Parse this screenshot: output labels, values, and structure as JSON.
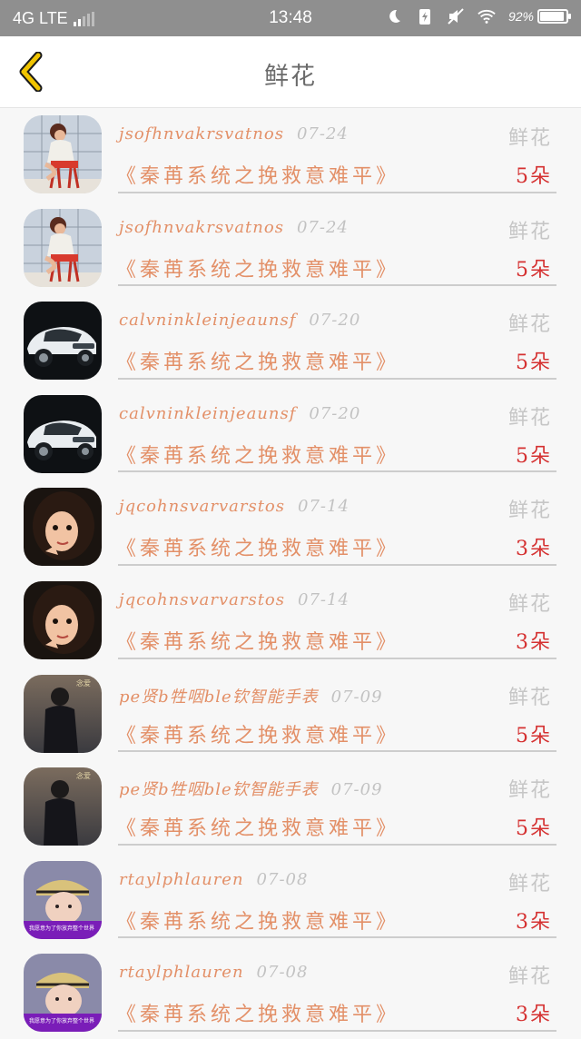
{
  "status_bar": {
    "network": "4G LTE",
    "time": "13:48",
    "battery": "92%",
    "battery_level": 0.92
  },
  "header": {
    "title": "鲜花",
    "back_icon": "chevron-left-icon",
    "accent": "#f0c400"
  },
  "colors": {
    "name_text": "#e39068",
    "date_text": "#c2c2c2",
    "count_text": "#d53131",
    "type_text": "#c6c6c6"
  },
  "items": [
    {
      "name": "jsofhnvakrsvatnos",
      "date": "07-24",
      "type": "鲜花",
      "book": "《秦苒系统之挽救意难平》",
      "count": "5朵",
      "avatar": "pinup"
    },
    {
      "name": "jsofhnvakrsvatnos",
      "date": "07-24",
      "type": "鲜花",
      "book": "《秦苒系统之挽救意难平》",
      "count": "5朵",
      "avatar": "pinup"
    },
    {
      "name": "calvninkleinjeaunsf",
      "date": "07-20",
      "type": "鲜花",
      "book": "《秦苒系统之挽救意难平》",
      "count": "5朵",
      "avatar": "car"
    },
    {
      "name": "calvninkleinjeaunsf",
      "date": "07-20",
      "type": "鲜花",
      "book": "《秦苒系统之挽救意难平》",
      "count": "5朵",
      "avatar": "car"
    },
    {
      "name": "jqcohnsvarvarstos",
      "date": "07-14",
      "type": "鲜花",
      "book": "《秦苒系统之挽救意难平》",
      "count": "3朵",
      "avatar": "girl"
    },
    {
      "name": "jqcohnsvarvarstos",
      "date": "07-14",
      "type": "鲜花",
      "book": "《秦苒系统之挽救意难平》",
      "count": "3朵",
      "avatar": "girl"
    },
    {
      "name": "pe贤b牲咽ble钦智能手表",
      "date": "07-09",
      "type": "鲜花",
      "book": "《秦苒系统之挽救意难平》",
      "count": "5朵",
      "avatar": "man"
    },
    {
      "name": "pe贤b牲咽ble钦智能手表",
      "date": "07-09",
      "type": "鲜花",
      "book": "《秦苒系统之挽救意难平》",
      "count": "5朵",
      "avatar": "man"
    },
    {
      "name": "rtaylphlauren",
      "date": "07-08",
      "type": "鲜花",
      "book": "《秦苒系统之挽救意难平》",
      "count": "3朵",
      "avatar": "cap"
    },
    {
      "name": "rtaylphlauren",
      "date": "07-08",
      "type": "鲜花",
      "book": "《秦苒系统之挽救意难平》",
      "count": "3朵",
      "avatar": "cap"
    }
  ]
}
